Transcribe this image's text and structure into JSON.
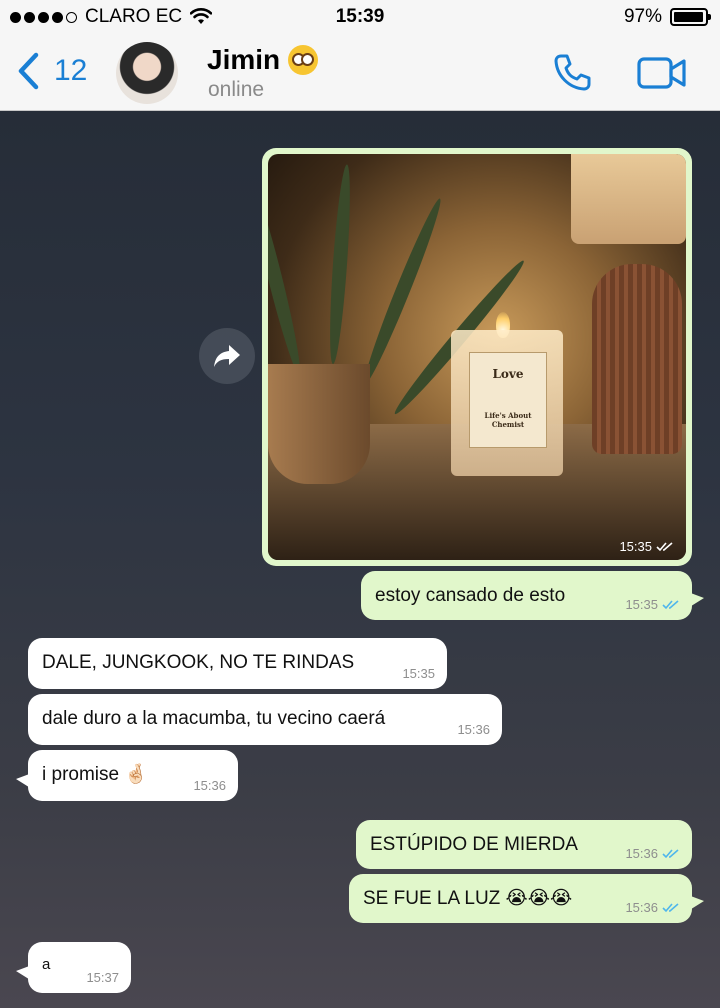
{
  "status_bar": {
    "carrier": "CLARO EC",
    "time": "15:39",
    "battery": "97%",
    "battery_level": 0.97
  },
  "header": {
    "back_count": "12",
    "contact_name": "Jimin",
    "contact_status": "online",
    "name_emoji": "nerd-face-icon"
  },
  "image_message": {
    "time": "15:35",
    "candle_label_title": "Love",
    "candle_label_subtitle": "Life's About Chemist"
  },
  "messages": [
    {
      "direction": "out",
      "text": "estoy cansado de esto",
      "time": "15:35"
    },
    {
      "direction": "in",
      "text": "DALE, JUNGKOOK, NO TE RINDAS",
      "time": "15:35"
    },
    {
      "direction": "in",
      "text": "dale duro a la macumba, tu vecino caerá",
      "time": "15:36"
    },
    {
      "direction": "in",
      "text": "i promise 🤞🏻",
      "time": "15:36"
    },
    {
      "direction": "out",
      "text": "ESTÚPIDO DE MIERDA",
      "time": "15:36"
    },
    {
      "direction": "out",
      "text": "SE FUE LA LUZ 😭😭😭",
      "time": "15:36"
    },
    {
      "direction": "in",
      "text": "a",
      "time": "15:37"
    }
  ],
  "colors": {
    "accent": "#1a7fd4",
    "outgoing_bubble": "#e1f7cb",
    "incoming_bubble": "#ffffff",
    "read_ticks": "#4fb6ec"
  }
}
